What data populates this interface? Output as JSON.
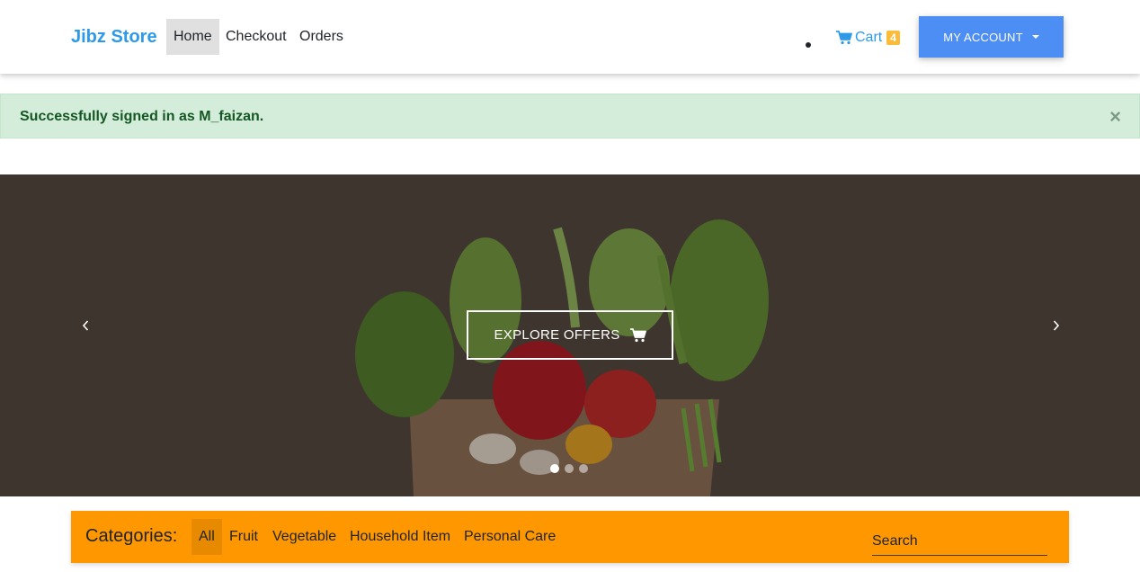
{
  "navbar": {
    "brand": "Jibz Store",
    "links": [
      {
        "label": "Home",
        "active": true
      },
      {
        "label": "Checkout",
        "active": false
      },
      {
        "label": "Orders",
        "active": false
      }
    ],
    "cart": {
      "label": "Cart",
      "count": "4",
      "icon": "shopping-cart-icon"
    },
    "account_label": "MY ACCOUNT",
    "colors": {
      "brand": "#2d9ae9",
      "account_button": "#4d8ef5",
      "badge": "#fbbb3b"
    }
  },
  "alert": {
    "message": "Successfully signed in as M_faizan.",
    "close": "×",
    "color": "#d4edda"
  },
  "carousel": {
    "button_label": "EXPLORE OFFERS",
    "button_icon": "shopping-cart-icon",
    "prev_icon": "chevron-left-icon",
    "next_icon": "chevron-right-icon",
    "slides": 3,
    "active_slide": 1
  },
  "categories": {
    "title": "Categories:",
    "items": [
      {
        "label": "All",
        "active": true
      },
      {
        "label": "Fruit",
        "active": false
      },
      {
        "label": "Vegetable",
        "active": false
      },
      {
        "label": "Household Item",
        "active": false
      },
      {
        "label": "Personal Care",
        "active": false
      }
    ],
    "search_placeholder": "Search",
    "color": "#ff9800"
  }
}
